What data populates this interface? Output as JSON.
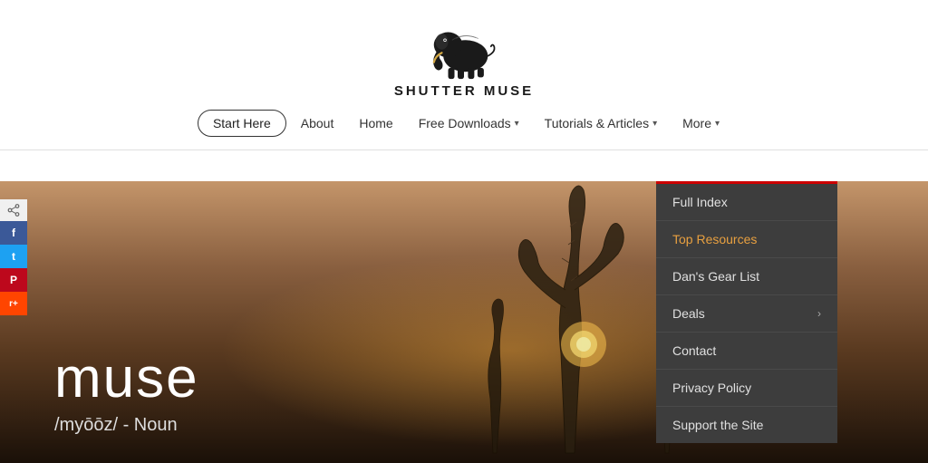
{
  "site": {
    "title": "SHUTTER MUSE"
  },
  "nav": {
    "start_here": "Start Here",
    "items": [
      {
        "label": "About",
        "has_arrow": false
      },
      {
        "label": "Home",
        "has_arrow": false
      },
      {
        "label": "Free Downloads",
        "has_arrow": true
      },
      {
        "label": "Tutorials & Articles",
        "has_arrow": true
      },
      {
        "label": "More",
        "has_arrow": true
      }
    ]
  },
  "hero": {
    "word": "muse",
    "phonetic": "/myōōz/ - Noun"
  },
  "social": {
    "share_icon": "⤢",
    "buttons": [
      {
        "label": "f",
        "platform": "facebook"
      },
      {
        "label": "t",
        "platform": "twitter"
      },
      {
        "label": "P",
        "platform": "pinterest"
      },
      {
        "label": "r",
        "platform": "reddit"
      }
    ]
  },
  "dropdown": {
    "items": [
      {
        "label": "Full Index",
        "active": false,
        "has_arrow": false
      },
      {
        "label": "Top Resources",
        "active": true,
        "has_arrow": false
      },
      {
        "label": "Dan's Gear List",
        "active": false,
        "has_arrow": false
      },
      {
        "label": "Deals",
        "active": false,
        "has_arrow": true
      },
      {
        "label": "Contact",
        "active": false,
        "has_arrow": false
      },
      {
        "label": "Privacy Policy",
        "active": false,
        "has_arrow": false
      },
      {
        "label": "Support the Site",
        "active": false,
        "has_arrow": false
      }
    ]
  }
}
